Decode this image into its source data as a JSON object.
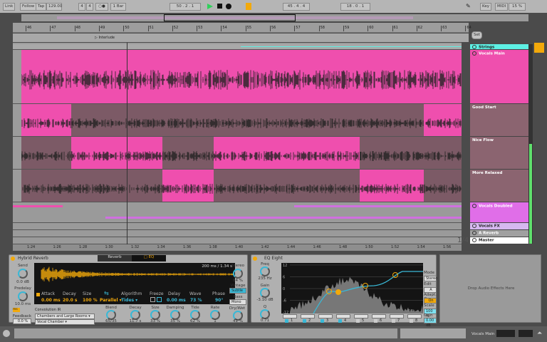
{
  "transport": {
    "link": "Link",
    "follow": "Follow",
    "tap": "Tap",
    "tempo": "129.00",
    "signature_num": "4",
    "signature_den": "4",
    "quantize": "1 Bar",
    "position": "50 . 2 . 1",
    "loop_start": "45 . 4 . 4",
    "loop_length": "18 . 0 . 1",
    "key": "Key",
    "midi": "MIDI",
    "cpu": "15 %"
  },
  "ruler": {
    "bars": [
      "46",
      "47",
      "48",
      "49",
      "50",
      "51",
      "52",
      "53",
      "54",
      "55",
      "56",
      "57",
      "58",
      "59",
      "60",
      "61",
      "62",
      "63",
      "64"
    ],
    "locator": "Interlude",
    "set": "Set"
  },
  "time_ruler": [
    "1:24",
    "1:26",
    "1:28",
    "1:30",
    "1:32",
    "1:34",
    "1:36",
    "1:38",
    "1:40",
    "1:42",
    "1:44",
    "1:46",
    "1:48",
    "1:50",
    "1:52",
    "1:54",
    "1:56"
  ],
  "zoom_label": "1/4",
  "tracks": [
    {
      "name": "Strings",
      "color": "#5ef0e4"
    },
    {
      "name": "Vocals Main",
      "color": "#ef4fae"
    },
    {
      "name": "Good Start",
      "color": "#8b6470"
    },
    {
      "name": "Nice Flow",
      "color": "#8b6470"
    },
    {
      "name": "More Relaxed",
      "color": "#8b6470"
    },
    {
      "name": "Vocals Doubled",
      "color": "#e06ee8"
    },
    {
      "name": "Vocals FX",
      "color": "#d6b8f0"
    },
    {
      "name": "A Reverb",
      "color": "#a0a0a0"
    },
    {
      "name": "Master",
      "color": "#ffffff"
    }
  ],
  "colors": {
    "clip_pink": "#ef4fae",
    "take_inactive": "#7c5a66",
    "accent": "#f2a90b",
    "cyan": "#39b8d6"
  },
  "reverb": {
    "title": "Hybrid Reverb",
    "tab_reverb": "Reverb",
    "tab_eq": "EQ",
    "send_label": "Send",
    "send": "0.0 dB",
    "predelay_label": "Predelay",
    "predelay": "10.0 ms",
    "ms": "ms",
    "feedback_label": "Feedback",
    "feedback": "0.0 %",
    "time_readout": "200 ms / 1.34 s",
    "attack_label": "Attack",
    "attack": "0.00 ms",
    "decay_label": "Decay",
    "decay": "20.0 s",
    "size_label": "Size",
    "size": "100 %",
    "routing": "Parallel",
    "algorithm_label": "Algorithm",
    "algorithm": "Tides",
    "freeze_label": "Freeze",
    "delay_label": "Delay",
    "delay": "0.00 ms",
    "wave_label": "Wave",
    "wave": "73 %",
    "phase_label": "Phase",
    "phase": "90°",
    "convolution_label": "Convolution IR",
    "ir_category": "Chambers and Large Rooms",
    "ir": "Vocal Chamber",
    "blend_label": "Blend",
    "blend": "65/35",
    "knobs": [
      {
        "label": "Decay",
        "value": "11.7 s"
      },
      {
        "label": "Size",
        "value": "33 %"
      },
      {
        "label": "Damping",
        "value": "35 %"
      },
      {
        "label": "Tide",
        "value": "62 %"
      },
      {
        "label": "Rate",
        "value": "1"
      }
    ],
    "stereo_label": "Stereo",
    "stereo": "84 %",
    "vintage_label": "Vintage",
    "vintage": "Subtle",
    "bass_label": "Bass",
    "bass": "Mono",
    "drywet_label": "Dry/Wet",
    "drywet": "41 %"
  },
  "eq": {
    "title": "EQ Eight",
    "freq_label": "Freq",
    "freq": "235 Hz",
    "gain_label": "Gain",
    "gain": "-3.10 dB",
    "q_label": "Q",
    "q": "0.71",
    "y_ticks": [
      "12",
      "6",
      "0",
      "-6",
      "-12"
    ],
    "x_ticks": [
      "100",
      "1k",
      "10k"
    ],
    "bands": [
      "1",
      "2",
      "3",
      "4",
      "5",
      "6",
      "7",
      "8"
    ],
    "mode_label": "Mode",
    "mode": "Stereo",
    "edit_label": "Edit",
    "edit": "A",
    "adapt_label": "Adapt. Q",
    "adapt": "On",
    "scale_label": "Scale",
    "scale": "100 %",
    "out_gain_label": "Gain",
    "out_gain": "0.00 dB"
  },
  "drop_area": "Drop Audio Effects Here",
  "status": {
    "track": "Vocals Main"
  }
}
